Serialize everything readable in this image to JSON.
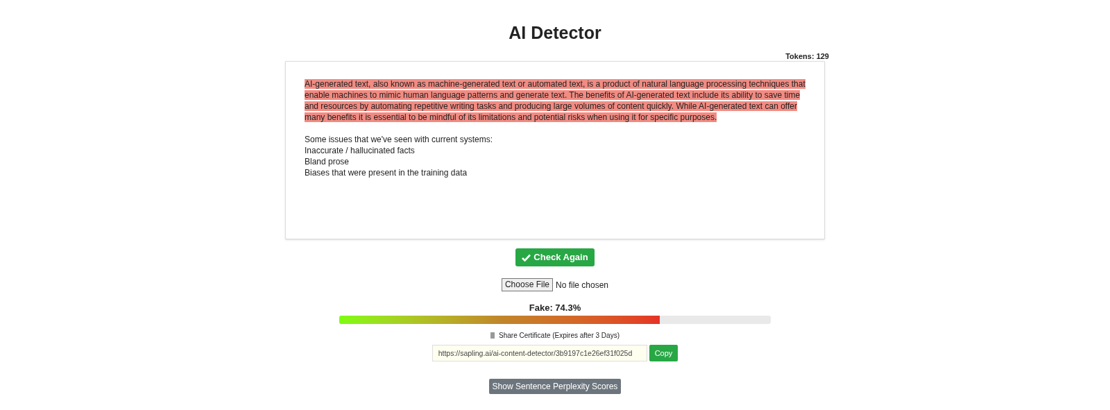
{
  "title": "AI Detector",
  "tokens": "Tokens: 129",
  "editor": {
    "paragraphs": [
      {
        "text": "AI-generated text, also known as machine-generated text or automated text, is a product of natural language processing techniques that enable machines to mimic human language patterns and generate text. The benefits of AI-generated text include its ability to save time and resources by automating repetitive writing tasks and producing large volumes of content quickly. While AI-generated text can offer many benefits it is essential to be mindful of its limitations and potential risks when using it for specific purposes.",
        "highlighted": true
      },
      {
        "text": "Some issues that we've seen with current systems:",
        "highlighted": false
      },
      {
        "text": "Inaccurate / hallucinated facts",
        "highlighted": false
      },
      {
        "text": "Bland prose",
        "highlighted": false
      },
      {
        "text": "Biases that were present in the training data",
        "highlighted": false
      }
    ]
  },
  "check_button": "Check Again",
  "file_input": {
    "button": "Choose File",
    "status": "No file chosen"
  },
  "result": {
    "label": "Fake: 74.3%",
    "level": 0.743
  },
  "share": {
    "label": "Share Certificate (Expires after 3 Days)",
    "url": "https://sapling.ai/ai-content-detector/3b9197c1e26ef31f025d",
    "copy_button": "Copy"
  },
  "perplexity_button": "Show Sentence Perplexity Scores"
}
